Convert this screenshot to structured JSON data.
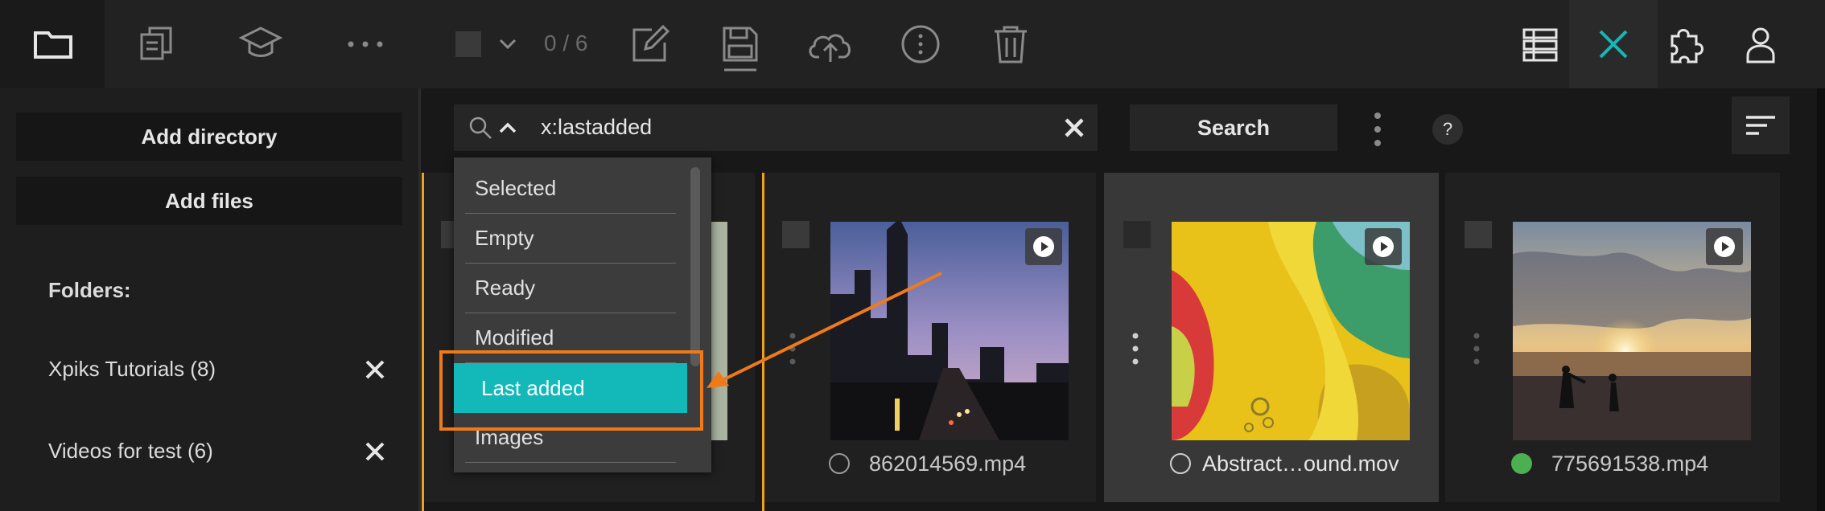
{
  "toolbar": {
    "counter": "0 / 6"
  },
  "sidebar": {
    "add_directory": "Add directory",
    "add_files": "Add files",
    "folders_label": "Folders:",
    "folders": [
      {
        "label": "Xpiks Tutorials (8)"
      },
      {
        "label": "Videos for test (6)"
      }
    ]
  },
  "search": {
    "query": "x:lastadded",
    "button": "Search",
    "help": "?"
  },
  "dropdown": {
    "items": [
      "Selected",
      "Empty",
      "Ready",
      "Modified",
      "Last added",
      "Images"
    ],
    "selected": "Last added"
  },
  "files": [
    {
      "name": "862014569.mp4",
      "status": "none"
    },
    {
      "name": "Abstract…ound.mov",
      "status": "none"
    },
    {
      "name": "775691538.mp4",
      "status": "ready"
    }
  ],
  "colors": {
    "accent": "#13b9b9",
    "annotation": "#f07a1a",
    "ready": "#4caf50"
  }
}
